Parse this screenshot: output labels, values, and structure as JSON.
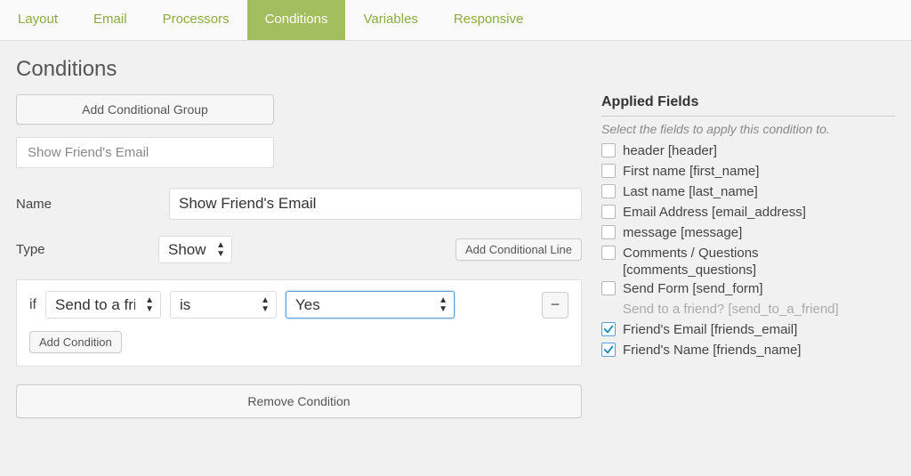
{
  "tabs": [
    "Layout",
    "Email",
    "Processors",
    "Conditions",
    "Variables",
    "Responsive"
  ],
  "active_tab_index": 3,
  "page_title": "Conditions",
  "buttons": {
    "add_group": "Add Conditional Group",
    "add_line": "Add Conditional Line",
    "add_condition": "Add Condition",
    "remove_condition": "Remove Condition"
  },
  "group_name_display": "Show Friend's Email",
  "labels": {
    "name": "Name",
    "type": "Type"
  },
  "form": {
    "name_value": "Show Friend's Email",
    "type_value": "Show"
  },
  "condition": {
    "if_text": "if",
    "field_value": "Send to a frien",
    "operator_value": "is",
    "compare_value": "Yes",
    "minus": "−"
  },
  "applied": {
    "heading": "Applied Fields",
    "hint": "Select the fields to apply this condition to.",
    "fields": [
      {
        "label": "header [header]",
        "checked": false
      },
      {
        "label": "First name [first_name]",
        "checked": false
      },
      {
        "label": "Last name [last_name]",
        "checked": false
      },
      {
        "label": "Email Address [email_address]",
        "checked": false
      },
      {
        "label": "message [message]",
        "checked": false
      },
      {
        "label": "Comments / Questions",
        "sub": "[comments_questions]",
        "checked": false
      },
      {
        "label": "Send Form [send_form]",
        "checked": false
      },
      {
        "label": "Send to a friend? [send_to_a_friend]",
        "checked": false,
        "disabled": true
      },
      {
        "label": "Friend's Email [friends_email]",
        "checked": true
      },
      {
        "label": "Friend's Name [friends_name]",
        "checked": true
      }
    ]
  }
}
